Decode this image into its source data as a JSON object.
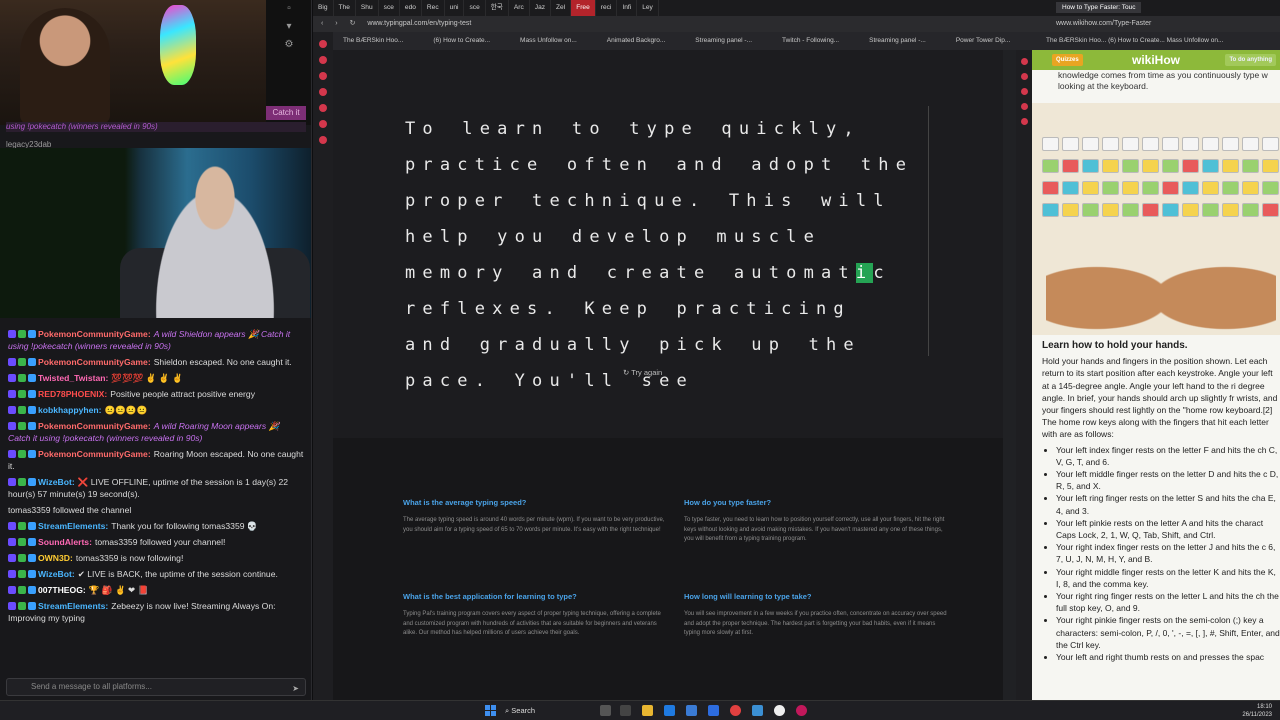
{
  "stream": {
    "overlay_note": "using !pokecatch (winners revealed in 90s)",
    "overlay_pill": "Catch it",
    "viewer_name": "legacy23dab",
    "chat_placeholder": "Send a message to all platforms...",
    "messages": [
      {
        "user": "PokemonCommunityGame:",
        "user_color": "#ff6b6b",
        "text": "A wild Shieldon appears 🎉 Catch it using !pokecatch (winners revealed in 90s)",
        "italic": true
      },
      {
        "user": "PokemonCommunityGame:",
        "user_color": "#ff6b6b",
        "text": "Shieldon escaped. No one caught it.",
        "italic": false
      },
      {
        "user": "Twisted_Twistan:",
        "user_color": "#ff69b4",
        "text": "💯💯💯 ✌ ✌ ✌",
        "italic": false
      },
      {
        "user": "RED78PHOENIX:",
        "user_color": "#ff4d4d",
        "text": "Positive people attract positive energy",
        "italic": false
      },
      {
        "user": "kobkhappyhen:",
        "user_color": "#4ab6ff",
        "text": "😐😐😐😐",
        "italic": false
      },
      {
        "user": "PokemonCommunityGame:",
        "user_color": "#ff6b6b",
        "text": "A wild Roaring Moon appears 🎉 Catch it using !pokecatch (winners revealed in 90s)",
        "italic": true
      },
      {
        "user": "PokemonCommunityGame:",
        "user_color": "#ff6b6b",
        "text": "Roaring Moon escaped. No one caught it.",
        "italic": false
      },
      {
        "user": "WizeBot:",
        "user_color": "#4ab6ff",
        "text": "❌ LIVE OFFLINE, uptime of the session is 1 day(s) 22 hour(s) 57 minute(s) 19 second(s).",
        "italic": false
      },
      {
        "user": "",
        "user_color": "#dcdcdc",
        "text": "tomas3359 followed the channel",
        "italic": false
      },
      {
        "user": "StreamElements:",
        "user_color": "#4ab6ff",
        "text": "Thank you for following tomas3359 💀",
        "italic": false
      },
      {
        "user": "SoundAlerts:",
        "user_color": "#ff69b4",
        "text": "tomas3359 followed your channel!",
        "italic": false
      },
      {
        "user": "OWN3D:",
        "user_color": "#ffcc33",
        "text": "tomas3359 is now following!",
        "italic": false
      },
      {
        "user": "WizeBot:",
        "user_color": "#4ab6ff",
        "text": "✔ LIVE is BACK, the uptime of the session continue.",
        "italic": false
      },
      {
        "user": "007THEOG:",
        "user_color": "#ffffff",
        "text": "🏆 🎒 ✌ ❤ 📕",
        "italic": false
      },
      {
        "user": "StreamElements:",
        "user_color": "#4ab6ff",
        "text": "Zebeezy is now live! Streaming Always On: Improving my typing",
        "italic": false
      }
    ]
  },
  "browser": {
    "tabs": [
      "Big",
      "The",
      "Shu",
      "sce",
      "edo",
      "Rec",
      "uni",
      "sce",
      "한국",
      "Arc",
      "Jaz",
      "Zel",
      "Free",
      "reci",
      "Infi",
      "Ley"
    ],
    "active_tab": "Free",
    "url": "www.typingpal.com/en/typing-test",
    "bookmarks": [
      "The BÆRSkin Hoo...",
      "(6) How to Create...",
      "Mass Unfollow on...",
      "Animated Backgro...",
      "Streaming panel -...",
      "Twitch - Following...",
      "Streaming panel -...",
      "Power Tower Dip..."
    ]
  },
  "typing_test": {
    "text_before": "To learn to type quickly, practice often and adopt the proper technique. This will help you develop muscle memory and create automat",
    "cursor_char": "i",
    "text_after": "c reflexes. Keep practicing and gradually pick up the pace. You'll see",
    "try_again": "Try again"
  },
  "faq": [
    {
      "q": "What is the average typing speed?",
      "a": "The average typing speed is around 40 words per minute (wpm). If you want to be very productive, you should aim for a typing speed of 65 to 70 words per minute. It's easy with the right technique!"
    },
    {
      "q": "How do you type faster?",
      "a": "To type faster, you need to learn how to position yourself correctly, use all your fingers, hit the right keys without looking and avoid making mistakes. If you haven't mastered any one of these things, you will benefit from a typing training program."
    },
    {
      "q": "What is the best application for learning to type?",
      "a": "Typing Pal's training program covers every aspect of proper typing technique, offering a complete and customized program with hundreds of activities that are suitable for beginners and veterans alike. Our method has helped millions of users achieve their goals."
    },
    {
      "q": "How long will learning to type take?",
      "a": "You will see improvement in a few weeks if you practice often, concentrate on accuracy over speed and adopt the proper technique. The hardest part is forgetting your bad habits, even if it means typing more slowly at first."
    }
  ],
  "wikihow": {
    "tab": "How to Type Faster: Touc",
    "url": "www.wikihow.com/Type-Faster",
    "bookmarks": "The BÆRSkin Hoo...  (6) How to Create...  Mass Unfollow on...",
    "brand": "wikiHow",
    "quizzes": "Quizzes",
    "search": "To do anything",
    "top_text": "knowledge comes from time as you continuously type w looking at the keyboard.",
    "heading": "Learn how to hold your hands.",
    "para": "Hold your hands and fingers in the position shown. Let each return to its start position after each keystroke. Angle your left at a 145-degree angle. Angle your left hand to the ri degree angle. In brief, your hands should arch up slightly fr wrists, and your fingers should rest lightly on the \"home row keyboard.[2] The home row keys along with the fingers that hit each letter with are as follows:",
    "items": [
      "Your left index finger rests on the letter F and hits the ch C, V, G, T, and 6.",
      "Your left middle finger rests on the letter D and hits the c D, R, 5, and X.",
      "Your left ring finger rests on the letter S and hits the cha E, 4, and 3.",
      "Your left pinkie rests on the letter A and hits the charact Caps Lock, 2, 1, W, Q, Tab, Shift, and Ctrl.",
      "Your right index finger rests on the letter J and hits the c 6, 7, U, J, N, M, H, Y, and B.",
      "Your right middle finger rests on the letter K and hits the K, I, 8, and the comma key.",
      "Your right ring finger rests on the letter L and hits the ch the full stop key, O, and 9.",
      "Your right pinkie finger rests on the semi-colon (;) key a characters: semi-colon, P, /, 0, ', -, =, [, ], #, Shift, Enter, and the Ctrl key.",
      "Your left and right thumb rests on and presses the spac"
    ]
  },
  "taskbar": {
    "search": "Search",
    "time": "18:10",
    "date": "26/11/2023"
  },
  "colors": {
    "accent": "#25a354",
    "link": "#4aa3e8",
    "brand": "#8db93a"
  }
}
